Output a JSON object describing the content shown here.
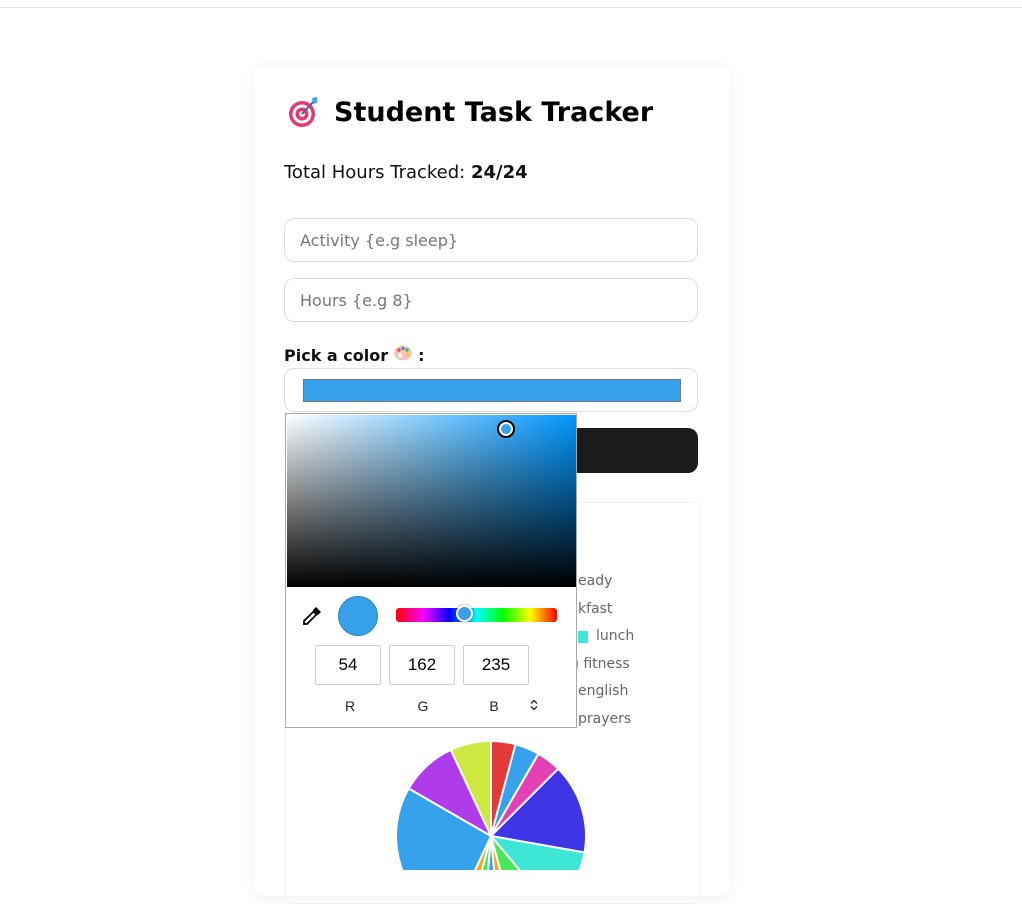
{
  "app": {
    "title": "Student Task Tracker",
    "title_icon": "direct-hit-icon",
    "total_label": "Total Hours Tracked:",
    "total_value": "24/24"
  },
  "form": {
    "activity_placeholder": "Activity {e.g sleep}",
    "hours_placeholder": "Hours {e.g 8}",
    "color_label": "Pick a color",
    "color_label_icon": "palette-icon",
    "color_label_suffix": ":",
    "selected_color": "#36a2eb"
  },
  "legend": {
    "items": [
      {
        "label": "eady"
      },
      {
        "label": "kfast"
      },
      {
        "label": "lunch",
        "color": "#3ee6d6"
      },
      {
        "label": "g fitness"
      },
      {
        "label": "english"
      },
      {
        "label": "prayers"
      }
    ]
  },
  "chart_data": {
    "type": "pie",
    "colors": [
      "#e53a3a",
      "#36a2eb",
      "#e43fb4",
      "#3d35e6",
      "#3ee6d6",
      "#46e857",
      "#f5a623",
      "#36a2eb",
      "#b03bea",
      "#cde83e"
    ]
  },
  "color_picker": {
    "r": "54",
    "g": "162",
    "b": "235",
    "r_label": "R",
    "g_label": "G",
    "b_label": "B"
  }
}
